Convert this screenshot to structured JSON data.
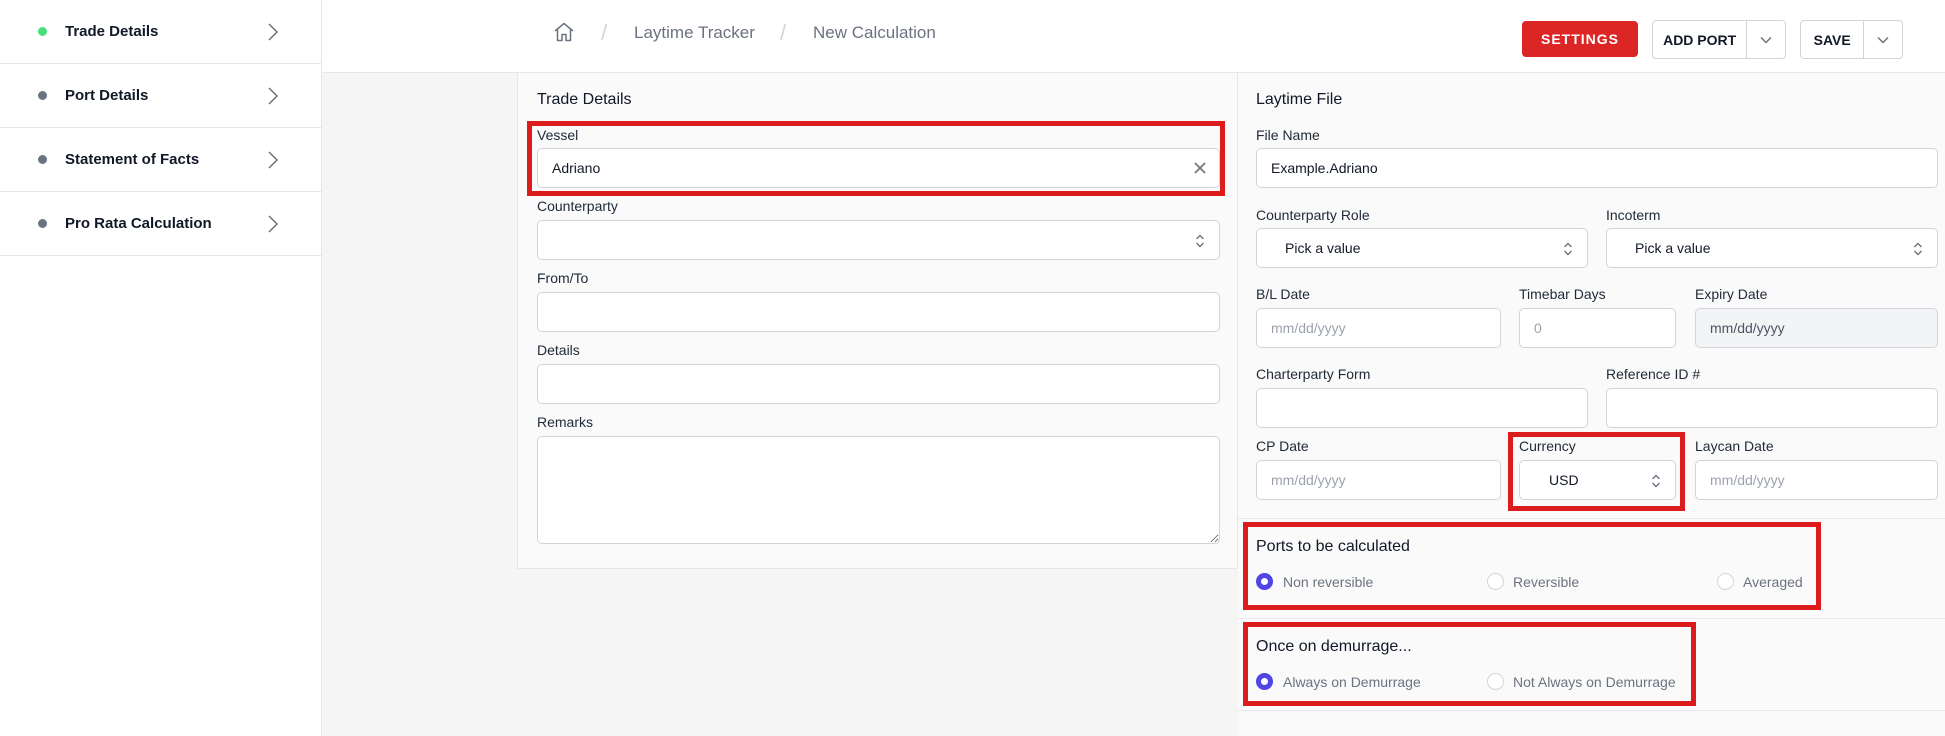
{
  "sidebar": {
    "items": [
      {
        "label": "Trade Details",
        "active": true
      },
      {
        "label": "Port Details",
        "active": false
      },
      {
        "label": "Statement of Facts",
        "active": false
      },
      {
        "label": "Pro Rata Calculation",
        "active": false
      }
    ]
  },
  "header": {
    "breadcrumb": [
      "Laytime Tracker",
      "New Calculation"
    ],
    "settings_label": "SETTINGS",
    "add_port_label": "ADD PORT",
    "save_label": "SAVE"
  },
  "trade_details": {
    "title": "Trade Details",
    "vessel_label": "Vessel",
    "vessel_value": "Adriano",
    "counterparty_label": "Counterparty",
    "counterparty_value": "",
    "from_to_label": "From/To",
    "from_to_value": "",
    "details_label": "Details",
    "details_value": "",
    "remarks_label": "Remarks",
    "remarks_value": ""
  },
  "laytime_file": {
    "title": "Laytime File",
    "file_name_label": "File Name",
    "file_name_value": "Example.Adriano",
    "counterparty_role_label": "Counterparty Role",
    "counterparty_role_value": "Pick a value",
    "incoterm_label": "Incoterm",
    "incoterm_value": "Pick a value",
    "bl_date_label": "B/L Date",
    "bl_date_placeholder": "mm/dd/yyyy",
    "timebar_days_label": "Timebar Days",
    "timebar_days_placeholder": "0",
    "expiry_date_label": "Expiry Date",
    "expiry_date_value": "mm/dd/yyyy",
    "charterparty_form_label": "Charterparty Form",
    "reference_id_label": "Reference ID #",
    "cp_date_label": "CP Date",
    "cp_date_placeholder": "mm/dd/yyyy",
    "currency_label": "Currency",
    "currency_value": "USD",
    "laycan_date_label": "Laycan Date",
    "laycan_date_placeholder": "mm/dd/yyyy"
  },
  "ports_calc": {
    "title": "Ports to be calculated",
    "options": [
      "Non reversible",
      "Reversible",
      "Averaged"
    ],
    "selected": "Non reversible"
  },
  "demurrage": {
    "title": "Once on demurrage...",
    "options": [
      "Always on Demurrage",
      "Not Always on Demurrage"
    ],
    "selected": "Always on Demurrage"
  },
  "colors": {
    "accent": "#dc2626",
    "radio_selected": "#4f46e5",
    "active_dot": "#4ade80",
    "highlight": "#dc1c1c"
  }
}
